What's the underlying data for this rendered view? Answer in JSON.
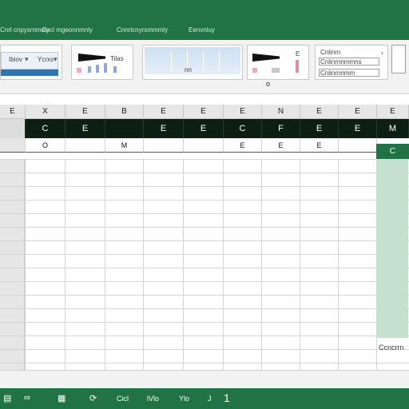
{
  "titlebar": {
    "items": [
      "Cnrl cnpysrnmely",
      "Cncl mgeonnmnly",
      "Cnnrlcnyrsmmmly",
      "Eenvnluy"
    ]
  },
  "ribbon": {
    "group1_text": "Ibiov",
    "group1_text2": "Ycrxs",
    "group2_text": "Tilas",
    "group3_text": "nn",
    "group4_text": "E",
    "group5_line1": "Cnlinrn",
    "group5_line2": "Cnlinrnnmmns",
    "group5_line3": "Cnlinrnnmm",
    "center_marker": "o"
  },
  "grid": {
    "column_headers": [
      "E",
      "X",
      "E",
      "B",
      "E",
      "E",
      "E",
      "N",
      "E",
      "E",
      "E"
    ],
    "row1": [
      "",
      "C",
      "E",
      "",
      "E",
      "E",
      "C",
      "F",
      "E",
      "E",
      "M"
    ],
    "row2": [
      "",
      "O",
      "",
      "M",
      "",
      "",
      "E",
      "E",
      "E",
      "",
      ""
    ],
    "corner_cell": "C",
    "side_label": "Ccncrrn"
  },
  "statusbar": {
    "icons": [
      "sheet-icon",
      "glasses-icon",
      "grid-icon",
      "sync-icon"
    ],
    "items": [
      "Cicl",
      "lVlo",
      "Ylo",
      "J"
    ],
    "cursor": "1"
  },
  "colors": {
    "brand_green": "#217346",
    "dark_band": "#0d1f13",
    "selection": "#c6e0cf"
  }
}
